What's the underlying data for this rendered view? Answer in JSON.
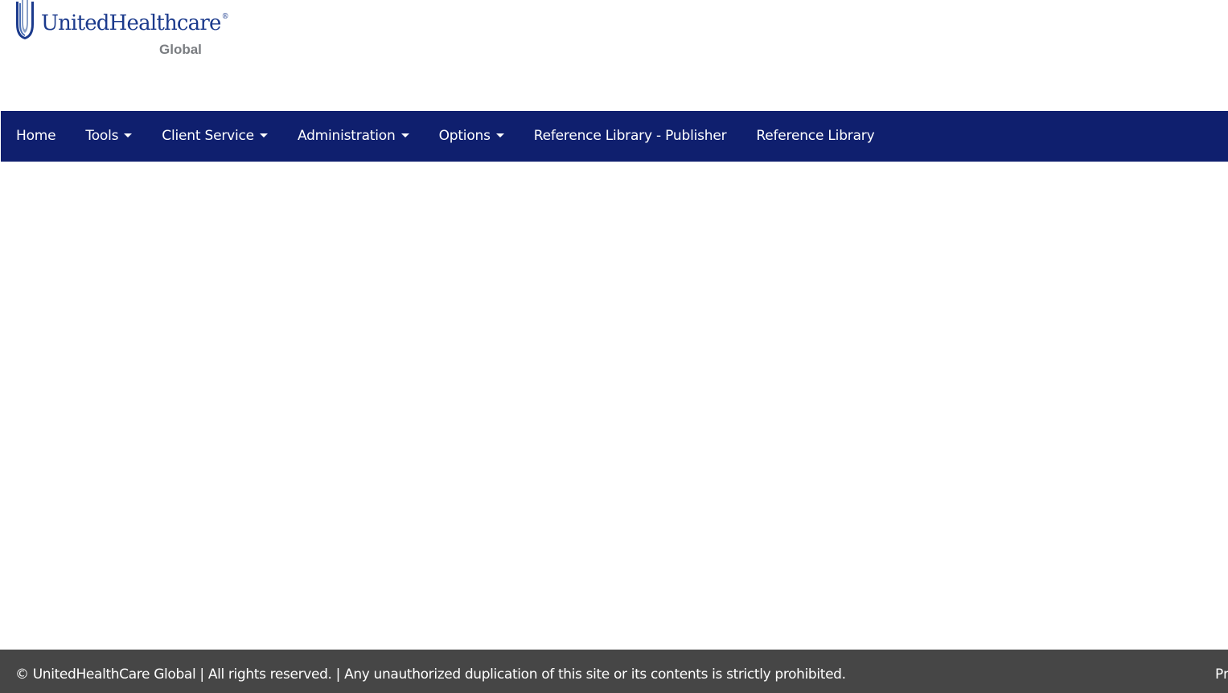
{
  "brand": {
    "name": "UnitedHealthcare",
    "registered_mark": "®",
    "sub": "Global",
    "mark_color": "#1b3a8c",
    "sub_color": "#7a7d81"
  },
  "nav": {
    "background": "#0f1f6e",
    "items": [
      {
        "label": "Home",
        "dropdown": false
      },
      {
        "label": "Tools",
        "dropdown": true
      },
      {
        "label": "Client Service",
        "dropdown": true
      },
      {
        "label": "Administration",
        "dropdown": true
      },
      {
        "label": "Options",
        "dropdown": true
      },
      {
        "label": "Reference Library - Publisher",
        "dropdown": false
      },
      {
        "label": "Reference Library",
        "dropdown": false
      }
    ]
  },
  "footer": {
    "background": "#464646",
    "copyright": "© UnitedHealthCare Global | All rights reserved. | Any unauthorized duplication of this site or its contents is strictly prohibited.",
    "right_link": "Pr"
  }
}
